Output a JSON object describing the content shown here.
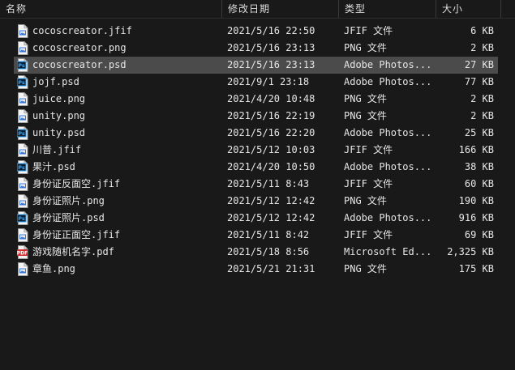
{
  "columns": {
    "name": "名称",
    "date": "修改日期",
    "type": "类型",
    "size": "大小"
  },
  "files": [
    {
      "name": "cocoscreator.jfif",
      "date": "2021/5/16 22:50",
      "type": "JFIF 文件",
      "size": "6 KB",
      "icon": "image-file-icon",
      "selected": false
    },
    {
      "name": "cocoscreator.png",
      "date": "2021/5/16 23:13",
      "type": "PNG 文件",
      "size": "2 KB",
      "icon": "image-file-icon",
      "selected": false
    },
    {
      "name": "cocoscreator.psd",
      "date": "2021/5/16 23:13",
      "type": "Adobe Photos...",
      "size": "27 KB",
      "icon": "photoshop-file-icon",
      "selected": true
    },
    {
      "name": "jojf.psd",
      "date": "2021/9/1 23:18",
      "type": "Adobe Photos...",
      "size": "77 KB",
      "icon": "photoshop-file-icon",
      "selected": false
    },
    {
      "name": "juice.png",
      "date": "2021/4/20 10:48",
      "type": "PNG 文件",
      "size": "2 KB",
      "icon": "image-file-icon",
      "selected": false
    },
    {
      "name": "unity.png",
      "date": "2021/5/16 22:19",
      "type": "PNG 文件",
      "size": "2 KB",
      "icon": "image-file-icon",
      "selected": false
    },
    {
      "name": "unity.psd",
      "date": "2021/5/16 22:20",
      "type": "Adobe Photos...",
      "size": "25 KB",
      "icon": "photoshop-file-icon",
      "selected": false
    },
    {
      "name": "川普.jfif",
      "date": "2021/5/12 10:03",
      "type": "JFIF 文件",
      "size": "166 KB",
      "icon": "image-file-icon",
      "selected": false
    },
    {
      "name": "果汁.psd",
      "date": "2021/4/20 10:50",
      "type": "Adobe Photos...",
      "size": "38 KB",
      "icon": "photoshop-file-icon",
      "selected": false
    },
    {
      "name": "身份证反面空.jfif",
      "date": "2021/5/11 8:43",
      "type": "JFIF 文件",
      "size": "60 KB",
      "icon": "image-file-icon",
      "selected": false
    },
    {
      "name": "身份证照片.png",
      "date": "2021/5/12 12:42",
      "type": "PNG 文件",
      "size": "190 KB",
      "icon": "image-file-icon",
      "selected": false
    },
    {
      "name": "身份证照片.psd",
      "date": "2021/5/12 12:42",
      "type": "Adobe Photos...",
      "size": "916 KB",
      "icon": "photoshop-file-icon",
      "selected": false
    },
    {
      "name": "身份证正面空.jfif",
      "date": "2021/5/11 8:42",
      "type": "JFIF 文件",
      "size": "69 KB",
      "icon": "image-file-icon",
      "selected": false
    },
    {
      "name": "游戏随机名字.pdf",
      "date": "2021/5/18 8:56",
      "type": "Microsoft Ed...",
      "size": "2,325 KB",
      "icon": "pdf-file-icon",
      "selected": false
    },
    {
      "name": "章鱼.png",
      "date": "2021/5/21 21:31",
      "type": "PNG 文件",
      "size": "175 KB",
      "icon": "image-file-icon",
      "selected": false
    }
  ],
  "colors": {
    "background": "#191919",
    "selected_row": "#4b4b4b",
    "photoshop_blue": "#31a8ff",
    "pdf_red": "#d32f2f",
    "text": "#e6e6e6"
  }
}
